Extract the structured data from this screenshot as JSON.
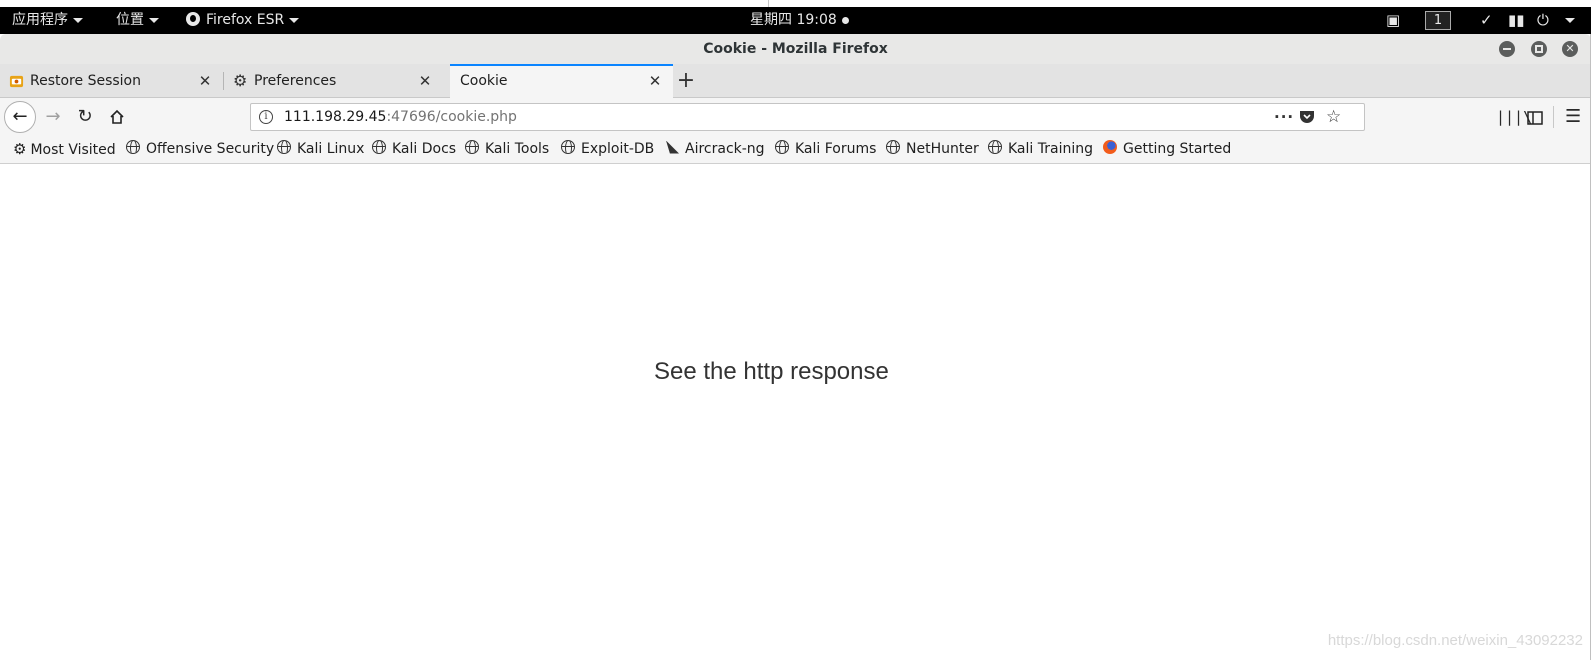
{
  "os_topbar": {
    "applications_label": "应用程序",
    "places_label": "位置",
    "active_app_label": "Firefox ESR",
    "clock": "星期四 19:08",
    "workspace_number": "1"
  },
  "window": {
    "title": "Cookie - Mozilla Firefox"
  },
  "tabs": [
    {
      "label": "Restore Session",
      "favicon": "restore-session-icon",
      "active": false
    },
    {
      "label": "Preferences",
      "favicon": "gear-icon",
      "active": false
    },
    {
      "label": "Cookie",
      "favicon": "",
      "active": true
    }
  ],
  "urlbar": {
    "host": "111.198.29.45",
    "rest": ":47696/cookie.php"
  },
  "bookmarks": [
    {
      "label": "Most Visited",
      "icon": "gear-icon"
    },
    {
      "label": "Offensive Security",
      "icon": "globe-icon"
    },
    {
      "label": "Kali Linux",
      "icon": "globe-icon"
    },
    {
      "label": "Kali Docs",
      "icon": "globe-icon"
    },
    {
      "label": "Kali Tools",
      "icon": "globe-icon"
    },
    {
      "label": "Exploit-DB",
      "icon": "globe-icon"
    },
    {
      "label": "Aircrack-ng",
      "icon": "aircrack-icon"
    },
    {
      "label": "Kali Forums",
      "icon": "globe-icon"
    },
    {
      "label": "NetHunter",
      "icon": "globe-icon"
    },
    {
      "label": "Kali Training",
      "icon": "globe-icon"
    },
    {
      "label": "Getting Started",
      "icon": "firefox-icon"
    }
  ],
  "page": {
    "message": "See the http response"
  },
  "watermark": "https://blog.csdn.net/weixin_43092232",
  "colors": {
    "tab_accent": "#0a84ff",
    "topbar_bg": "#000000",
    "chrome_bg": "#f5f5f5"
  }
}
